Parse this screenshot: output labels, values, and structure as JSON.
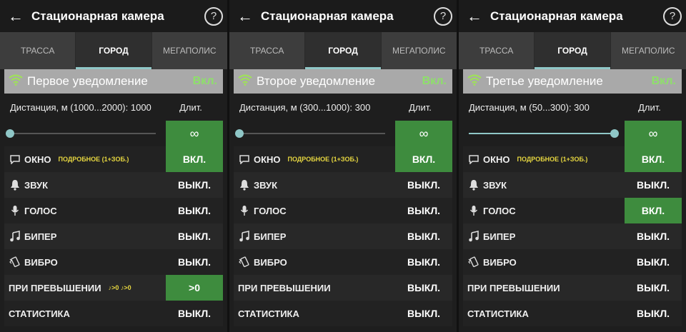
{
  "screens": [
    {
      "title": "Стационарная камера",
      "tabs": [
        "ТРАССА",
        "ГОРОД",
        "МЕГАПОЛИС"
      ],
      "active_tab": 1,
      "peek_left": "ВИБРО",
      "peek_right": "ВЫКЛ.",
      "notification": {
        "title": "Первое уведомление",
        "state": "Вкл."
      },
      "distance_text": "Дистанция, м (1000...2000): 1000",
      "duration_label": "Длит.",
      "slider_value": 0.0,
      "infinity": "∞",
      "rows": [
        {
          "icon": "chat-icon",
          "label": "ОКНО",
          "sub": "ПОДРОБНОЕ (1+ЗОБ.)",
          "value": "ВКЛ.",
          "on": true
        },
        {
          "icon": "bell-icon",
          "label": "ЗВУК",
          "sub": "",
          "value": "ВЫКЛ.",
          "on": false
        },
        {
          "icon": "mic-icon",
          "label": "ГОЛОС",
          "sub": "",
          "value": "ВЫКЛ.",
          "on": false
        },
        {
          "icon": "note-icon",
          "label": "БИПЕР",
          "sub": "",
          "value": "ВЫКЛ.",
          "on": false
        },
        {
          "icon": "vibro-icon",
          "label": "ВИБРО",
          "sub": "",
          "value": "ВЫКЛ.",
          "on": false
        },
        {
          "icon": "",
          "label": "ПРИ ПРЕВЫШЕНИИ",
          "sub": "♪>0 ♪>0",
          "value": ">0",
          "on": true
        },
        {
          "icon": "",
          "label": "СТАТИСТИКА",
          "sub": "",
          "value": "ВЫКЛ.",
          "on": false
        }
      ]
    },
    {
      "title": "Стационарная камера",
      "tabs": [
        "ТРАССА",
        "ГОРОД",
        "МЕГАПОЛИС"
      ],
      "active_tab": 1,
      "peek_left": "СТАТИСТИКА",
      "peek_right": "ВЫКЛ.",
      "notification": {
        "title": "Второе уведомление",
        "state": "Вкл."
      },
      "distance_text": "Дистанция, м (300...1000): 300",
      "duration_label": "Длит.",
      "slider_value": 0.0,
      "infinity": "∞",
      "rows": [
        {
          "icon": "chat-icon",
          "label": "ОКНО",
          "sub": "ПОДРОБНОЕ (1+ЗОБ.)",
          "value": "ВКЛ.",
          "on": true
        },
        {
          "icon": "bell-icon",
          "label": "ЗВУК",
          "sub": "",
          "value": "ВЫКЛ.",
          "on": false
        },
        {
          "icon": "mic-icon",
          "label": "ГОЛОС",
          "sub": "",
          "value": "ВЫКЛ.",
          "on": false
        },
        {
          "icon": "note-icon",
          "label": "БИПЕР",
          "sub": "",
          "value": "ВЫКЛ.",
          "on": false
        },
        {
          "icon": "vibro-icon",
          "label": "ВИБРО",
          "sub": "",
          "value": "ВЫКЛ.",
          "on": false
        },
        {
          "icon": "",
          "label": "ПРИ ПРЕВЫШЕНИИ",
          "sub": "",
          "value": "ВЫКЛ.",
          "on": false
        },
        {
          "icon": "",
          "label": "СТАТИСТИКА",
          "sub": "",
          "value": "ВЫКЛ.",
          "on": false
        }
      ]
    },
    {
      "title": "Стационарная камера",
      "tabs": [
        "ТРАССА",
        "ГОРОД",
        "МЕГАПОЛИС"
      ],
      "active_tab": 1,
      "peek_left": "",
      "peek_right": "",
      "notification": {
        "title": "Третье уведомление",
        "state": "Вкл."
      },
      "distance_text": "Дистанция, м (50...300): 300",
      "duration_label": "Длит.",
      "slider_value": 1.0,
      "infinity": "∞",
      "rows": [
        {
          "icon": "chat-icon",
          "label": "ОКНО",
          "sub": "ПОДРОБНОЕ (1+ЗОБ.)",
          "value": "ВКЛ.",
          "on": true
        },
        {
          "icon": "bell-icon",
          "label": "ЗВУК",
          "sub": "",
          "value": "ВЫКЛ.",
          "on": false
        },
        {
          "icon": "mic-icon",
          "label": "ГОЛОС",
          "sub": "",
          "value": "ВКЛ.",
          "on": true
        },
        {
          "icon": "note-icon",
          "label": "БИПЕР",
          "sub": "",
          "value": "ВЫКЛ.",
          "on": false
        },
        {
          "icon": "vibro-icon",
          "label": "ВИБРО",
          "sub": "",
          "value": "ВЫКЛ.",
          "on": false
        },
        {
          "icon": "",
          "label": "ПРИ ПРЕВЫШЕНИИ",
          "sub": "",
          "value": "ВЫКЛ.",
          "on": false
        },
        {
          "icon": "",
          "label": "СТАТИСТИКА",
          "sub": "",
          "value": "ВЫКЛ.",
          "on": false
        }
      ]
    }
  ],
  "colors": {
    "on": "#3e8c3e",
    "accent": "#8fc7c7",
    "state_text": "#8ee06a",
    "sub_text": "#e6d640"
  }
}
